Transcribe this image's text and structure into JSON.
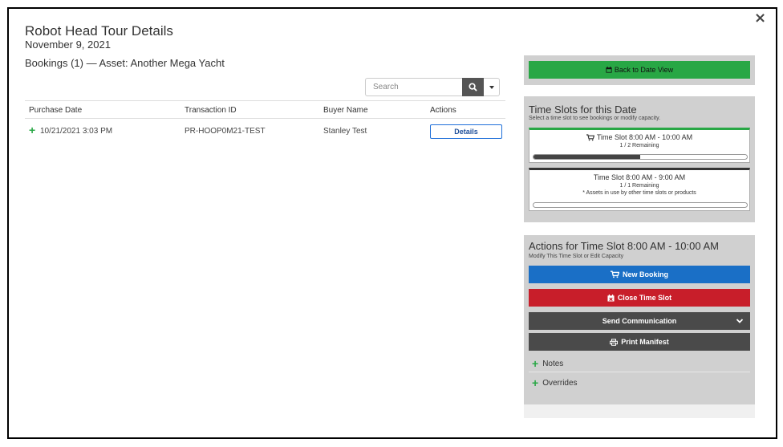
{
  "header": {
    "title": "Robot Head Tour Details",
    "date": "November 9, 2021",
    "bookings_label": "Bookings (1) — Asset: Another Mega Yacht",
    "close_glyph": "×"
  },
  "search": {
    "placeholder": "Search",
    "icon": "search-icon"
  },
  "table": {
    "headers": [
      "Purchase Date",
      "Transaction ID",
      "Buyer Name",
      "Actions"
    ],
    "rows": [
      {
        "expand": "+",
        "purchase_date": "10/21/2021 3:03 PM",
        "transaction_id": "PR-HOOP0M21-TEST",
        "buyer_name": "Stanley Test",
        "action_label": "Details"
      }
    ]
  },
  "sidebar": {
    "back_label": "Back to Date View",
    "time_slots_title": "Time Slots for this Date",
    "time_slots_subtitle": "Select a time slot to see bookings or modify capacity.",
    "slots": [
      {
        "label": "Time Slot 8:00 AM - 10:00 AM",
        "remaining": "1 / 2 Remaining",
        "fill_fraction": 0.5,
        "note": "",
        "selected": true,
        "accent": "#28a745"
      },
      {
        "label": "Time Slot 8:00 AM - 9:00 AM",
        "remaining": "1 / 1 Remaining",
        "fill_fraction": 0,
        "note": "* Assets in use by other time slots or products",
        "selected": false,
        "accent": "#333333"
      }
    ],
    "actions_title": "Actions for Time Slot 8:00 AM - 10:00 AM",
    "actions_subtitle": "Modify This Time Slot or Edit Capacity",
    "buttons": {
      "new_booking": "New Booking",
      "close_slot": "Close Time Slot",
      "send_comm": "Send Communication",
      "print_manifest": "Print Manifest"
    },
    "accordions": [
      "Notes",
      "Overrides"
    ]
  },
  "colors": {
    "green": "#28a745",
    "blue": "#1a6fc6",
    "red": "#c81e2a",
    "dark": "#4a4a4a"
  }
}
